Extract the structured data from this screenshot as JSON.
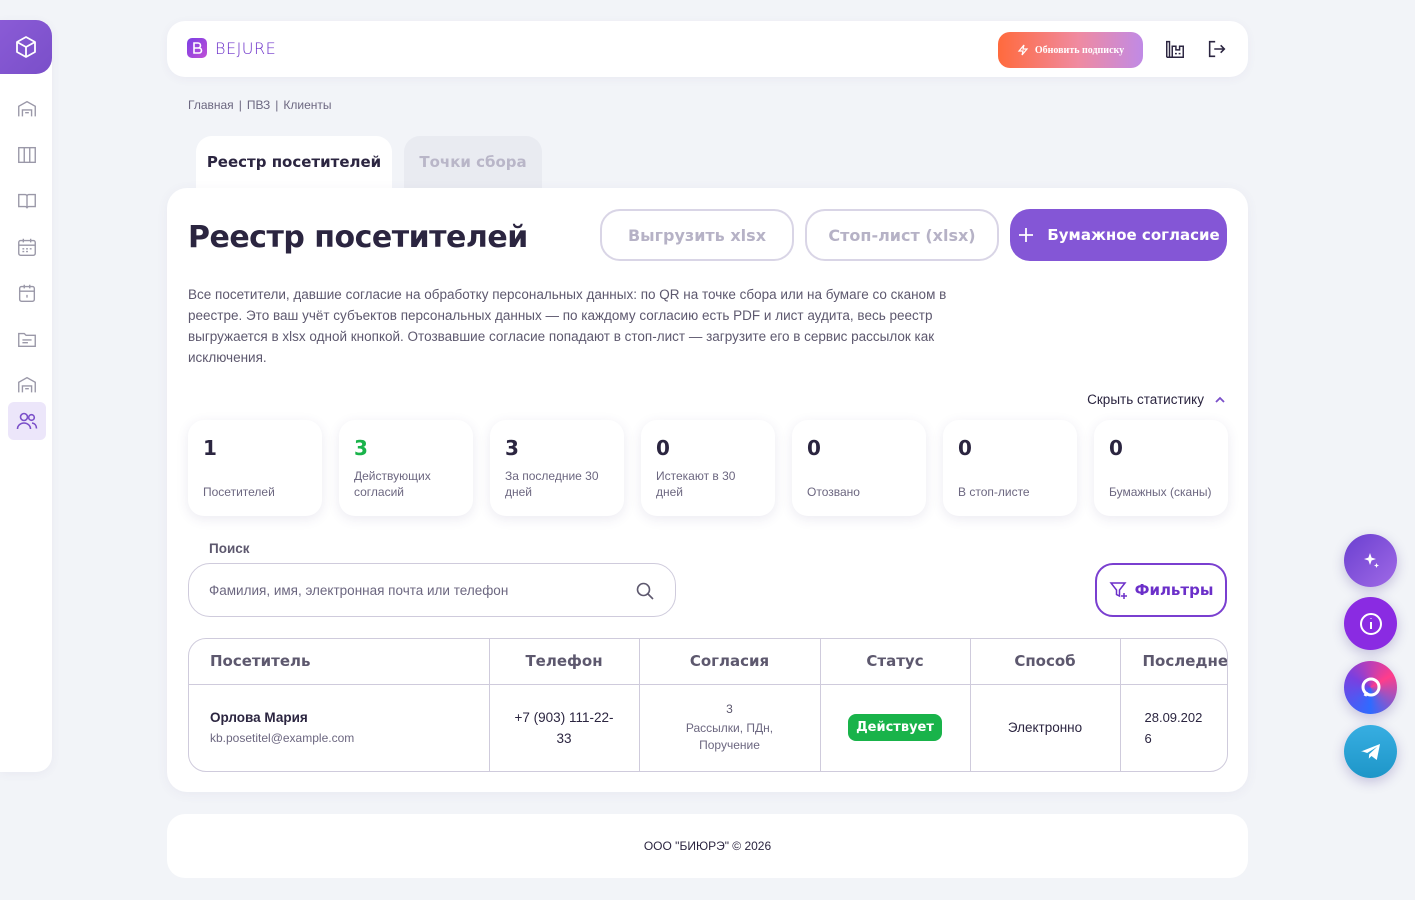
{
  "header": {
    "logo_text": "BEJURE",
    "upgrade_label": "Обновить подписку",
    "icons": [
      "building-chart-icon",
      "logout-icon"
    ]
  },
  "sidebar": {
    "items": [
      {
        "icon": "cube-icon",
        "active": true
      },
      {
        "icon": "warehouse-icon"
      },
      {
        "icon": "columns-icon"
      },
      {
        "icon": "book-icon"
      },
      {
        "icon": "calendar-grid-icon"
      },
      {
        "icon": "calendar-icon"
      },
      {
        "icon": "folder-icon"
      },
      {
        "icon": "warehouse-icon"
      },
      {
        "icon": "users-icon",
        "active": true
      }
    ]
  },
  "breadcrumb": {
    "items": [
      "Главная",
      "ПВЗ",
      "Клиенты"
    ],
    "separator": "|"
  },
  "tabs": [
    {
      "label": "Реестр посетителей",
      "active": true
    },
    {
      "label": "Точки сбора",
      "active": false
    }
  ],
  "main": {
    "title": "Реестр посетителей",
    "export_label": "Выгрузить xlsx",
    "stoplist_label": "Стоп-лист (xlsx)",
    "paper_consent_label": "Бумажное согласие",
    "description": "Все посетители, давшие согласие на обработку персональных данных: по QR на точке сбора или на бумаге со сканом в реестре. Это ваш учёт субъектов персональных данных — по каждому согласию есть PDF и лист аудита, весь реестр выгружается в xlsx одной кнопкой. Отозвавшие согласие попадают в стоп-лист — загрузите его в сервис рассылок как исключения.",
    "hide_stats_label": "Скрыть статистику"
  },
  "stats": [
    {
      "value": "1",
      "label": "Посетителей"
    },
    {
      "value": "3",
      "label": "Действующих согласий",
      "color": "#19b34a"
    },
    {
      "value": "3",
      "label": "За последние 30 дней"
    },
    {
      "value": "0",
      "label": "Истекают в 30 дней"
    },
    {
      "value": "0",
      "label": "Отозвано"
    },
    {
      "value": "0",
      "label": "В стоп-листе"
    },
    {
      "value": "0",
      "label": "Бумажных (сканы)"
    }
  ],
  "search": {
    "label": "Поиск",
    "placeholder": "Фамилия, имя, электронная почта или телефон",
    "filters_label": "Фильтры"
  },
  "table": {
    "columns": [
      "Посетитель",
      "Телефон",
      "Согласия",
      "Статус",
      "Способ",
      "Последнее"
    ],
    "rows": [
      {
        "name": "Орлова Мария",
        "email": "kb.posetitel@example.com",
        "phone": "+7 (903) 111-22-33",
        "consent_count": "3",
        "consent_types": "Рассылки, ПДн, Поручение",
        "status": "Действует",
        "method": "Электронно",
        "last": "28.09.2026"
      }
    ]
  },
  "footer": {
    "text": "ООО \"БИЮРЭ\" © 2026"
  },
  "floating": [
    "sparkle-icon",
    "info-icon",
    "chat-icon",
    "telegram-icon"
  ],
  "colors": {
    "accent": "#8456d6",
    "brand": "#6b2fc9",
    "success": "#19b34a",
    "background": "#f2f4f8"
  }
}
